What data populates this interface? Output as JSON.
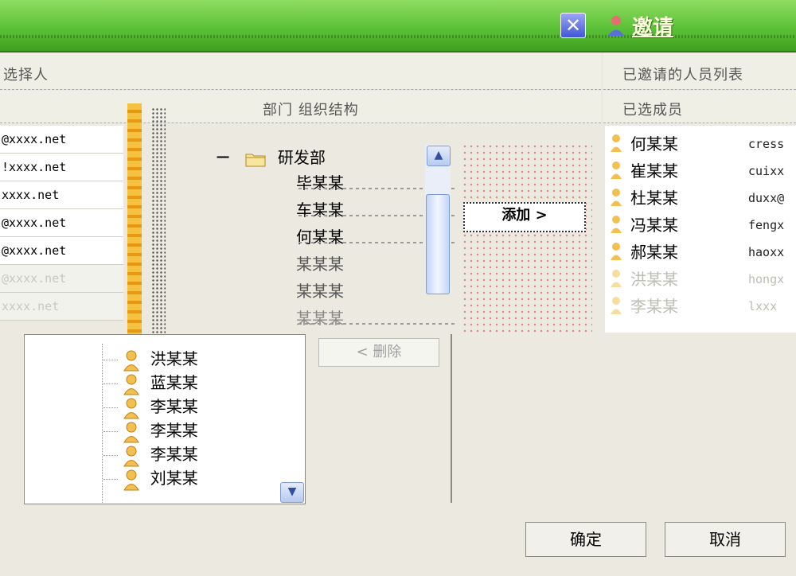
{
  "window": {
    "title": "邀请",
    "close_label": "✕"
  },
  "strips": {
    "top_left": "选择人",
    "top_right": "已邀请的人员列表",
    "mid_center": "部门 组织结构",
    "mid_right": "已选成员"
  },
  "emails": [
    "@xxxx.net",
    "!xxxx.net",
    "xxxx.net",
    "@xxxx.net",
    "@xxxx.net",
    "@xxxx.net",
    "xxxx.net"
  ],
  "department": {
    "toggle": "−",
    "name": "研发部",
    "members": [
      "毕某某",
      "车某某",
      "何某某",
      "某某某",
      "某某某",
      "某某某"
    ]
  },
  "tree": {
    "items": [
      "洪某某",
      "蓝某某",
      "李某某",
      "李某某",
      "李某某",
      "刘某某"
    ]
  },
  "buttons": {
    "add": "添加 >",
    "delete": "< 删除",
    "confirm": "确定",
    "cancel": "取消"
  },
  "scroll": {
    "up": "▲",
    "down": "▼"
  },
  "selected": [
    {
      "name": "何某某",
      "email": "cress"
    },
    {
      "name": "崔某某",
      "email": "cuixx"
    },
    {
      "name": "杜某某",
      "email": "duxx@"
    },
    {
      "name": "冯某某",
      "email": "fengx"
    },
    {
      "name": "郝某某",
      "email": "haoxx"
    },
    {
      "name": "洪某某",
      "email": "hongx"
    },
    {
      "name": "李某某",
      "email": "lxxx"
    }
  ],
  "colors": {
    "title_bar": "#5cc238",
    "close": "#4257d6",
    "accent_orange": "#e49a10"
  }
}
